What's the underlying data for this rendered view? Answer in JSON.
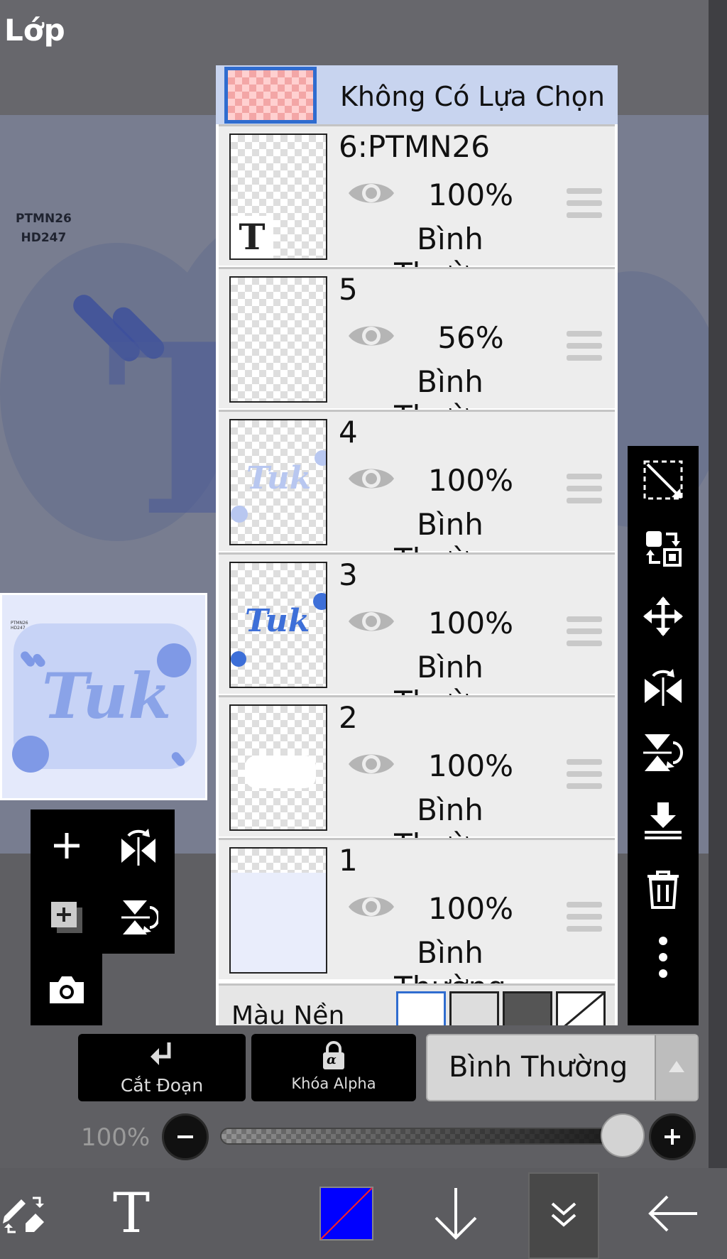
{
  "header": {
    "title": "Lớp"
  },
  "canvas": {
    "label_line1": "PTMN26",
    "label_line2": "HD247",
    "big_letter": "T"
  },
  "preview": {
    "word": "Tuk",
    "tiny_line1": "PTMN26",
    "tiny_line2": "HD247"
  },
  "selection_row": {
    "label": "Không Có Lựa Chọn"
  },
  "layers": [
    {
      "name": "6:PTMN26",
      "opacity": "100%",
      "blend": "Bình Thường",
      "thumb_glyph": "T"
    },
    {
      "name": "5",
      "opacity": "56%",
      "blend": "Bình Thường"
    },
    {
      "name": "4",
      "opacity": "100%",
      "blend": "Bình Thường",
      "thumb_word": "Tuk"
    },
    {
      "name": "3",
      "opacity": "100%",
      "blend": "Bình Thường",
      "thumb_word": "Tuk"
    },
    {
      "name": "2",
      "opacity": "100%",
      "blend": "Bình Thường"
    },
    {
      "name": "1",
      "opacity": "100%",
      "blend": "Bình Thường"
    }
  ],
  "background_row": {
    "label": "Màu Nền"
  },
  "buttons": {
    "clip": "Cắt Đoạn",
    "alpha_lock": "Khóa Alpha",
    "alpha_glyph": "α"
  },
  "blend_select": {
    "value": "Bình Thường"
  },
  "opacity_slider": {
    "label": "100%",
    "value": 100
  },
  "bottom_bar": {
    "text_tool": "T",
    "color": "#0000ff"
  },
  "colors": {
    "accent": "#2f6ccf",
    "panel_bg": "#ededed",
    "toolbar": "#000000"
  }
}
